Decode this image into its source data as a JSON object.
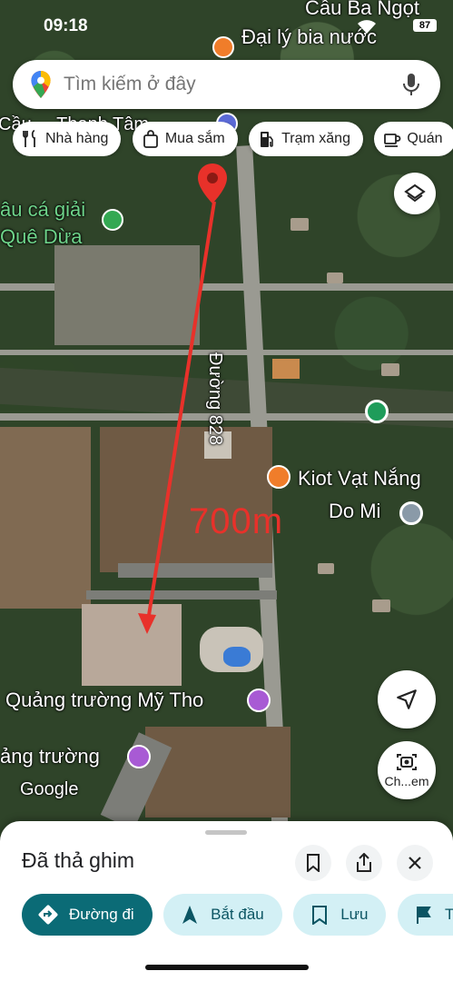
{
  "status_bar": {
    "time": "09:18",
    "battery": "87"
  },
  "search": {
    "placeholder": "Tìm kiếm ở đây"
  },
  "chips": [
    {
      "label": "Nhà hàng",
      "icon": "fork-knife-icon"
    },
    {
      "label": "Mua sắm",
      "icon": "shopping-bag-icon"
    },
    {
      "label": "Trạm xăng",
      "icon": "gas-station-icon"
    },
    {
      "label": "Quán",
      "icon": "coffee-cup-icon"
    }
  ],
  "map_labels": {
    "cau_ba_ngot": "Cầu Ba Ngọt",
    "dai_ly_bia": "Đại lý bia nước",
    "thanh_tam": "Cầu ... Thanh Tâm",
    "cau_ca": "âu cá giải",
    "que_dua": "Quê Dừa",
    "duong_828": "Đường 828",
    "kiot_line1": "Kiot Vạt Nắng",
    "kiot_line2": "Do Mi",
    "distance": "700m",
    "quang_truong_my_tho": "Quảng trường Mỹ Tho",
    "quang_truong": "ảng trường",
    "google": "Google"
  },
  "buttons": {
    "camera_label": "Ch...em"
  },
  "sheet": {
    "title": "Đã thả ghim",
    "actions": [
      {
        "label": "Đường đi",
        "icon": "directions-icon"
      },
      {
        "label": "Bắt đầu",
        "icon": "navigation-arrow-icon"
      },
      {
        "label": "Lưu",
        "icon": "bookmark-icon"
      },
      {
        "label": "Thê",
        "icon": "flag-icon"
      }
    ]
  },
  "colors": {
    "accent": "#0b6b76",
    "pin": "#e8312a",
    "annotation": "#e8312a"
  }
}
